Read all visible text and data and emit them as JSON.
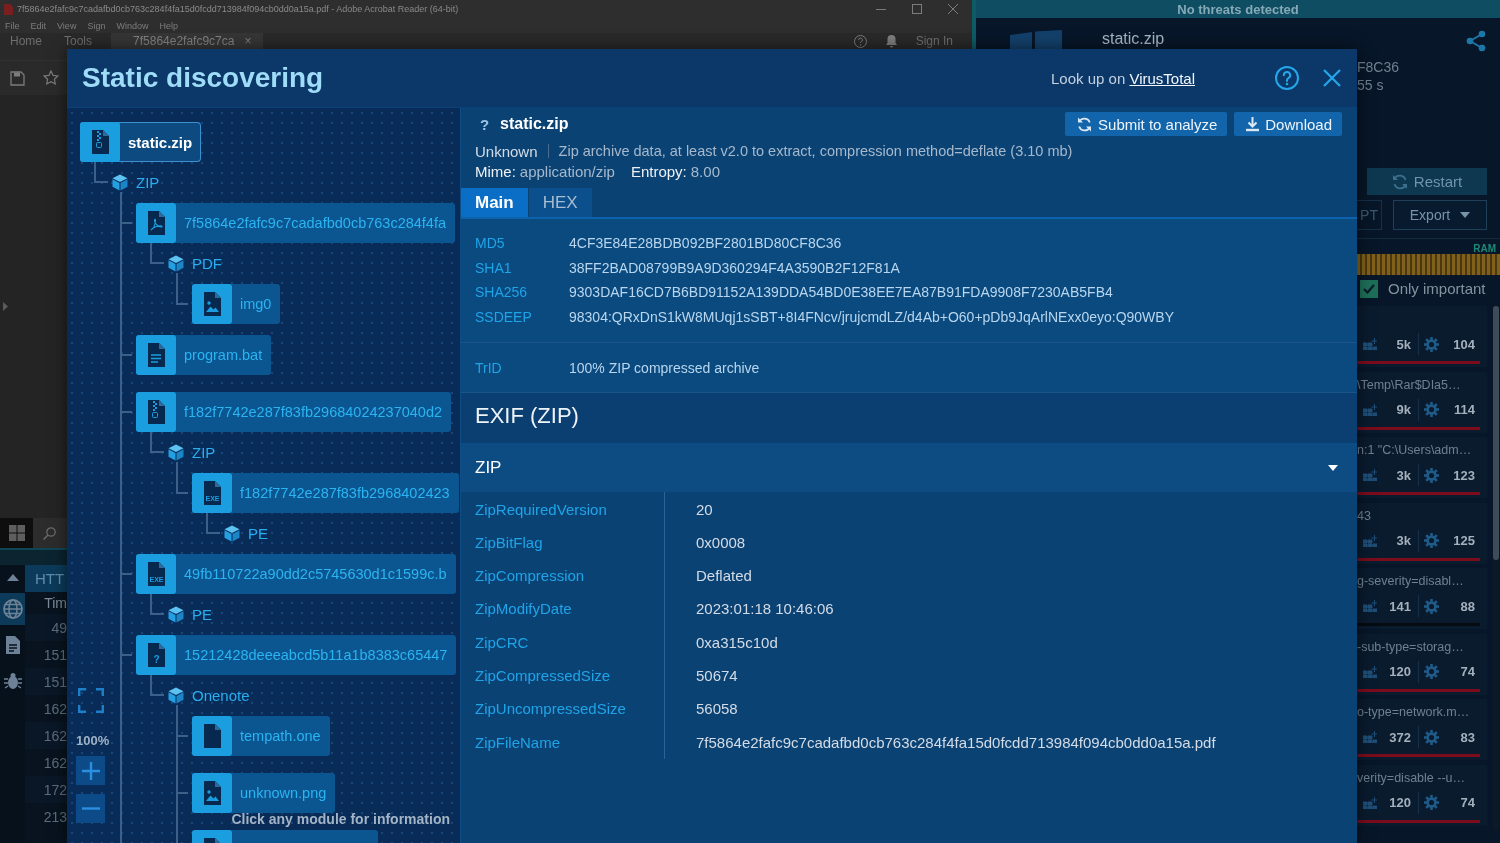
{
  "background": {
    "acrobat": {
      "title": "7f5864e2fafc9c7cadafbd0cb763c284f4fa15d0fcdd713984f094cb0dd0a15a.pdf - Adobe Acrobat Reader (64-bit)",
      "menu": [
        "File",
        "Edit",
        "View",
        "Sign",
        "Window",
        "Help"
      ],
      "tabs": [
        {
          "label": "Home",
          "selected": false
        },
        {
          "label": "Tools",
          "selected": false
        },
        {
          "label": "7f5864e2fafc9c7ca",
          "selected": true,
          "close": "×"
        }
      ],
      "sign_in": "Sign In"
    },
    "http_panel": {
      "nav": [
        {
          "kind": "network",
          "selected": true
        },
        {
          "kind": "files",
          "selected": false
        },
        {
          "kind": "threats",
          "selected": false
        }
      ],
      "header": "HTT",
      "column": "Tim",
      "times": [
        "49",
        "151",
        "151",
        "162",
        "162",
        "162",
        "172",
        "213"
      ]
    },
    "task_panel": {
      "status": "No threats detected",
      "file": "static.zip",
      "hash_tail": "F8C36",
      "duration": "55 s",
      "restart": "Restart",
      "cut_button": "PT",
      "export": "Export",
      "ram_label": "RAM",
      "only_important": {
        "label": "Only important",
        "checked": true
      },
      "processes": [
        {
          "events": "5k",
          "modules": "104",
          "color": "#7a0c1c"
        },
        {
          "path": "\\Temp\\Rar$DIa5…",
          "events": "9k",
          "modules": "114",
          "color": "#7a0c1c"
        },
        {
          "path": "n:1 \"C:\\Users\\adm…",
          "events": "3k",
          "modules": "123",
          "color": "#7a0c1c"
        },
        {
          "path": "43",
          "events": "3k",
          "modules": "125",
          "color": "#7a0c1c"
        },
        {
          "path": "g-severity=disabl…",
          "events": "141",
          "modules": "88",
          "color": "#060b12"
        },
        {
          "path": "-sub-type=storag…",
          "events": "120",
          "modules": "74",
          "color": "#7a0c1c"
        },
        {
          "path": "o-type=network.m…",
          "events": "372",
          "modules": "83",
          "color": "#7a0c1c"
        },
        {
          "path": "verity=disable --u…",
          "events": "120",
          "modules": "74",
          "color": "#7a0c1c"
        }
      ]
    }
  },
  "modal": {
    "title": "Static discovering",
    "lookup": {
      "prefix": "Look up on",
      "link": "VirusTotal"
    },
    "tree": [
      {
        "kind": "zip",
        "label": "static.zip",
        "selected": true,
        "children": [
          {
            "kind": "format",
            "label": "ZIP",
            "continues": true,
            "children": [
              {
                "kind": "pdf",
                "label": "7f5864e2fafc9c7cadafbd0cb763c284f4fa",
                "selected": false,
                "children": [
                  {
                    "kind": "format",
                    "label": "PDF",
                    "children": [
                      {
                        "kind": "image",
                        "label": "img0",
                        "selected": false
                      }
                    ]
                  }
                ]
              },
              {
                "kind": "text",
                "label": "program.bat",
                "selected": false
              },
              {
                "kind": "zip",
                "label": "f182f7742e287f83fb29684024237040d2",
                "selected": false,
                "children": [
                  {
                    "kind": "format",
                    "label": "ZIP",
                    "children": [
                      {
                        "kind": "labeled",
                        "badge": "EXE",
                        "label": "f182f7742e287f83fb2968402423",
                        "selected": false,
                        "children": [
                          {
                            "kind": "format",
                            "label": "PE"
                          }
                        ]
                      }
                    ]
                  }
                ]
              },
              {
                "kind": "labeled",
                "badge": "EXE",
                "label": "49fb110722a90dd2c5745630d1c1599c.b",
                "selected": false,
                "children": [
                  {
                    "kind": "format",
                    "label": "PE"
                  }
                ]
              },
              {
                "kind": "labeled",
                "badge": "?",
                "label": "15212428deeeabcd5b11a1b8383c65447",
                "selected": false,
                "children": [
                  {
                    "kind": "format",
                    "label": "Onenote",
                    "children": [
                      {
                        "kind": "blank",
                        "label": "tempath.one",
                        "selected": false
                      },
                      {
                        "kind": "image",
                        "label": "unknown.png",
                        "selected": false
                      },
                      {
                        "kind": "blank",
                        "selected": false
                      }
                    ]
                  }
                ]
              }
            ]
          }
        ]
      }
    ],
    "zoom": {
      "level": "100%"
    },
    "hint": "Click any module for information",
    "detail": {
      "status_glyph": "?",
      "file": "static.zip",
      "actions": [
        {
          "kind": "submit",
          "label": "Submit to analyze"
        },
        {
          "kind": "download",
          "label": "Download"
        }
      ],
      "type": "Unknown",
      "description": "Zip archive data, at least v2.0 to extract, compression method=deflate (3.10 mb)",
      "mime": {
        "label": "Mime:",
        "value": "application/zip"
      },
      "entropy": {
        "label": "Entropy:",
        "value": "8.00"
      },
      "tabs": [
        {
          "label": "Main",
          "selected": true
        },
        {
          "label": "HEX",
          "selected": false
        }
      ],
      "hashes": [
        {
          "name": "MD5",
          "value": "4CF3E84E28BDB092BF2801BD80CF8C36"
        },
        {
          "name": "SHA1",
          "value": "38FF2BAD08799B9A9D360294F4A3590B2F12F81A"
        },
        {
          "name": "SHA256",
          "value": "9303DAF16CD7B6BD91152A139DDA54BD0E38EE7EA87B91FDA9908F7230AB5FB4"
        },
        {
          "name": "SSDEEP",
          "value": "98304:QRxDnS1kW8MUqj1sSBT+8I4FNcv/jrujcmdLZ/d4Ab+O60+pDb9JqArlNExx0eyo:Q90WBY"
        }
      ],
      "trid": {
        "name": "TrID",
        "value": "100% ZIP compressed archive"
      },
      "exif_title": "EXIF (ZIP)",
      "exif_group": {
        "title": "ZIP",
        "expanded": true,
        "rows": [
          {
            "name": "ZipRequiredVersion",
            "value": "20"
          },
          {
            "name": "ZipBitFlag",
            "value": "0x0008"
          },
          {
            "name": "ZipCompression",
            "value": "Deflated"
          },
          {
            "name": "ZipModifyDate",
            "value": "2023:01:18 10:46:06"
          },
          {
            "name": "ZipCRC",
            "value": "0xa315c10d"
          },
          {
            "name": "ZipCompressedSize",
            "value": "50674"
          },
          {
            "name": "ZipUncompressedSize",
            "value": "56058"
          },
          {
            "name": "ZipFileName",
            "value": "7f5864e2fafc9c7cadafbd0cb763c284f4fa15d0fcdd713984f094cb0dd0a15a.pdf"
          }
        ]
      }
    }
  }
}
